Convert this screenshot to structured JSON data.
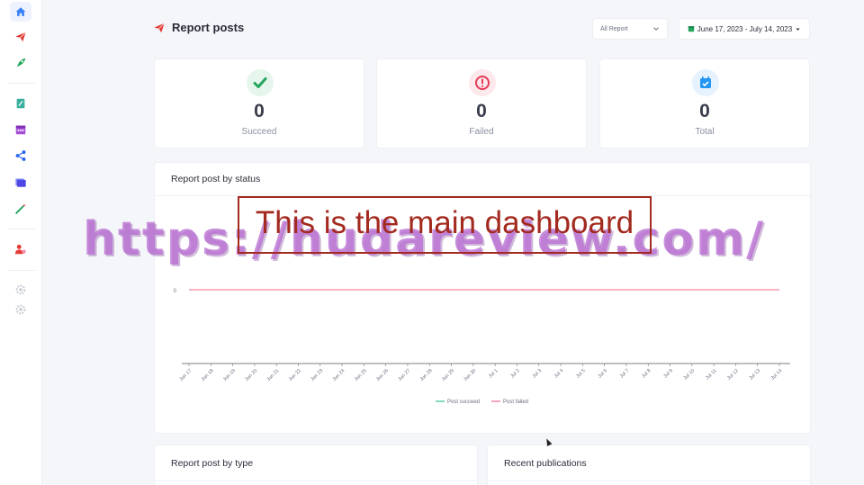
{
  "sidebar": {
    "items": [
      {
        "icon": "home-icon",
        "color": "#3b82f6"
      },
      {
        "icon": "paper-plane-icon",
        "color": "#e53935"
      },
      {
        "icon": "rocket-icon",
        "color": "#22a55b"
      },
      {
        "icon": "file-edit-icon",
        "color": "#3aaf9f"
      },
      {
        "icon": "calendar-icon",
        "color": "#a44fd6"
      },
      {
        "icon": "share-icon",
        "color": "#2563eb"
      },
      {
        "icon": "folders-icon",
        "color": "#4f46e5"
      },
      {
        "icon": "magic-wand-icon",
        "color": "#22a55b"
      },
      {
        "icon": "users-icon",
        "color": "#e53935"
      },
      {
        "icon": "settings-icon",
        "color": "#c7cad3"
      },
      {
        "icon": "settings-icon",
        "color": "#c7cad3"
      }
    ]
  },
  "header": {
    "title": "Report posts",
    "title_icon_color": "#e53935",
    "filter": {
      "selected": "All Report"
    },
    "date_range": "June 17, 2023 - July 14, 2023"
  },
  "stats": [
    {
      "value": "0",
      "label": "Succeed",
      "icon": "check-badge-icon",
      "color": "#22a55b",
      "bg": "#e6f6ec"
    },
    {
      "value": "0",
      "label": "Failed",
      "icon": "alert-badge-icon",
      "color": "#e53955",
      "bg": "#fde8ec"
    },
    {
      "value": "0",
      "label": "Total",
      "icon": "calendar-check-icon",
      "color": "#2196f3",
      "bg": "#e6f2fd"
    }
  ],
  "status_panel": {
    "title": "Report post by status",
    "chart_data": {
      "type": "line",
      "x": [
        "Jun 17",
        "Jun 18",
        "Jun 19",
        "Jun 20",
        "Jun 21",
        "Jun 22",
        "Jun 23",
        "Jun 24",
        "Jun 25",
        "Jun 26",
        "Jun 27",
        "Jun 28",
        "Jun 29",
        "Jun 30",
        "Jul 1",
        "Jul 2",
        "Jul 3",
        "Jul 4",
        "Jul 5",
        "Jul 6",
        "Jul 7",
        "Jul 8",
        "Jul 9",
        "Jul 10",
        "Jul 11",
        "Jul 12",
        "Jul 13",
        "Jul 14"
      ],
      "yticks": [
        "0"
      ],
      "series": [
        {
          "name": "Post succeed",
          "color": "#34c38f",
          "values": [
            0,
            0,
            0,
            0,
            0,
            0,
            0,
            0,
            0,
            0,
            0,
            0,
            0,
            0,
            0,
            0,
            0,
            0,
            0,
            0,
            0,
            0,
            0,
            0,
            0,
            0,
            0,
            0
          ]
        },
        {
          "name": "Post failed",
          "color": "#f46a8a",
          "values": [
            0,
            0,
            0,
            0,
            0,
            0,
            0,
            0,
            0,
            0,
            0,
            0,
            0,
            0,
            0,
            0,
            0,
            0,
            0,
            0,
            0,
            0,
            0,
            0,
            0,
            0,
            0,
            0
          ]
        }
      ],
      "grid": false,
      "legend": "bottom"
    }
  },
  "type_panel": {
    "title": "Report post by type"
  },
  "recent_panel": {
    "title": "Recent publications"
  },
  "overlay": {
    "caption": "This is the main dashboard",
    "watermark": "https://hudareview.com/"
  }
}
